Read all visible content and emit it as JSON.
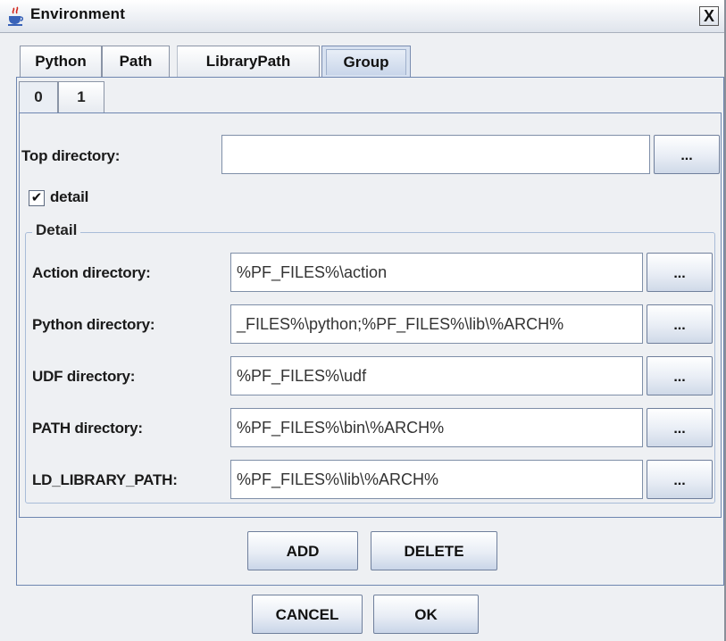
{
  "window": {
    "title": "Environment",
    "close_glyph": "X",
    "app_icon": "java-cup-icon"
  },
  "tabs": [
    {
      "label": "Python",
      "selected": false
    },
    {
      "label": "Path",
      "selected": false
    },
    {
      "label": "LibraryPath",
      "selected": false
    },
    {
      "label": "Group",
      "selected": true
    }
  ],
  "group_tabs": [
    {
      "label": "0",
      "selected": true
    },
    {
      "label": "1",
      "selected": false
    }
  ],
  "top_directory": {
    "label": "Top directory:",
    "value": "",
    "browse_label": "..."
  },
  "detail_checkbox": {
    "label": "detail",
    "checked": true,
    "mark": "✔"
  },
  "detail_group": {
    "title": "Detail",
    "fields": [
      {
        "label": "Action directory:",
        "value": "%PF_FILES%\\action",
        "browse_label": "..."
      },
      {
        "label": "Python directory:",
        "value": "_FILES%\\python;%PF_FILES%\\lib\\%ARCH%",
        "browse_label": "..."
      },
      {
        "label": "UDF directory:",
        "value": "%PF_FILES%\\udf",
        "browse_label": "..."
      },
      {
        "label": "PATH directory:",
        "value": "%PF_FILES%\\bin\\%ARCH%",
        "browse_label": "..."
      },
      {
        "label": "LD_LIBRARY_PATH:",
        "value": "%PF_FILES%\\lib\\%ARCH%",
        "browse_label": "..."
      }
    ]
  },
  "group_buttons": {
    "add": "ADD",
    "delete": "DELETE"
  },
  "dialog_buttons": {
    "cancel": "CANCEL",
    "ok": "OK"
  }
}
